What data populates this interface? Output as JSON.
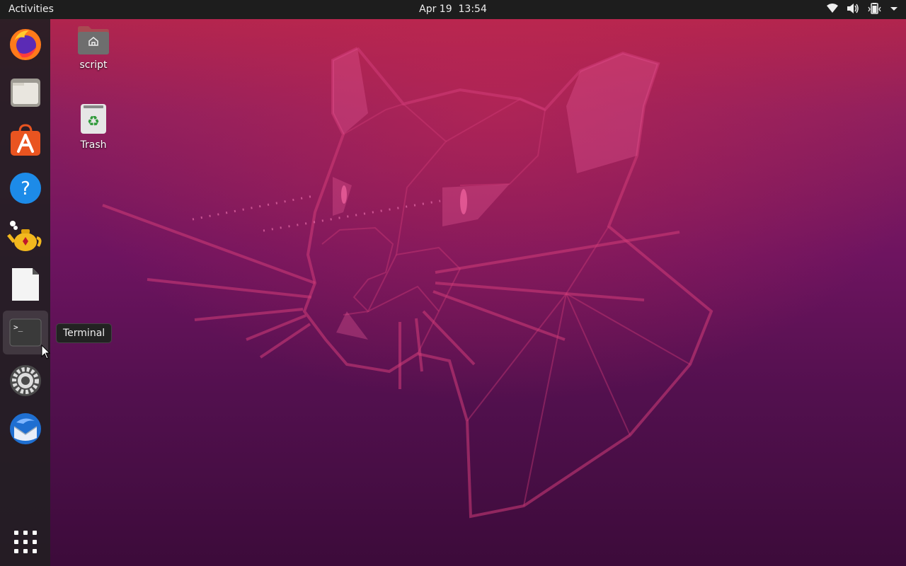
{
  "topbar": {
    "activities_label": "Activities",
    "date": "Apr 19",
    "time": "13:54",
    "tray_icons": [
      "wifi-icon",
      "volume-icon",
      "battery-icon",
      "system-menu-chevron-icon"
    ]
  },
  "dock": {
    "items": [
      {
        "name": "Firefox",
        "icon": "firefox-icon"
      },
      {
        "name": "Files",
        "icon": "files-icon"
      },
      {
        "name": "Ubuntu Software",
        "icon": "software-icon"
      },
      {
        "name": "Help",
        "icon": "help-icon"
      },
      {
        "name": "Teapot app",
        "icon": "teapot-icon"
      },
      {
        "name": "LibreOffice",
        "icon": "document-icon"
      },
      {
        "name": "Terminal",
        "icon": "terminal-icon",
        "active": true
      },
      {
        "name": "Settings",
        "icon": "settings-icon"
      },
      {
        "name": "Thunderbird",
        "icon": "thunderbird-icon"
      }
    ],
    "show_apps_icon": "app-grid-icon"
  },
  "desktop": {
    "icons": [
      {
        "label": "script",
        "icon": "home-folder-icon"
      },
      {
        "label": "Trash",
        "icon": "trash-icon"
      }
    ]
  },
  "tooltip": {
    "text": "Terminal"
  },
  "colors": {
    "topbar": "#1d1d1d",
    "wallpaper_top": "#b8264a",
    "wallpaper_bottom": "#3c0b3a",
    "accent_orange": "#e95420"
  }
}
